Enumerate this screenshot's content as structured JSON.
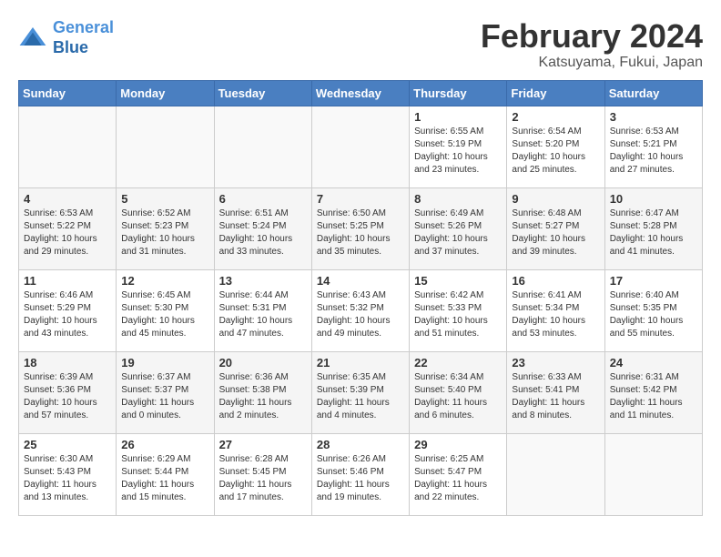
{
  "header": {
    "logo_line1": "General",
    "logo_line2": "Blue",
    "title": "February 2024",
    "subtitle": "Katsuyama, Fukui, Japan"
  },
  "weekdays": [
    "Sunday",
    "Monday",
    "Tuesday",
    "Wednesday",
    "Thursday",
    "Friday",
    "Saturday"
  ],
  "weeks": [
    [
      {
        "day": "",
        "info": ""
      },
      {
        "day": "",
        "info": ""
      },
      {
        "day": "",
        "info": ""
      },
      {
        "day": "",
        "info": ""
      },
      {
        "day": "1",
        "info": "Sunrise: 6:55 AM\nSunset: 5:19 PM\nDaylight: 10 hours\nand 23 minutes."
      },
      {
        "day": "2",
        "info": "Sunrise: 6:54 AM\nSunset: 5:20 PM\nDaylight: 10 hours\nand 25 minutes."
      },
      {
        "day": "3",
        "info": "Sunrise: 6:53 AM\nSunset: 5:21 PM\nDaylight: 10 hours\nand 27 minutes."
      }
    ],
    [
      {
        "day": "4",
        "info": "Sunrise: 6:53 AM\nSunset: 5:22 PM\nDaylight: 10 hours\nand 29 minutes."
      },
      {
        "day": "5",
        "info": "Sunrise: 6:52 AM\nSunset: 5:23 PM\nDaylight: 10 hours\nand 31 minutes."
      },
      {
        "day": "6",
        "info": "Sunrise: 6:51 AM\nSunset: 5:24 PM\nDaylight: 10 hours\nand 33 minutes."
      },
      {
        "day": "7",
        "info": "Sunrise: 6:50 AM\nSunset: 5:25 PM\nDaylight: 10 hours\nand 35 minutes."
      },
      {
        "day": "8",
        "info": "Sunrise: 6:49 AM\nSunset: 5:26 PM\nDaylight: 10 hours\nand 37 minutes."
      },
      {
        "day": "9",
        "info": "Sunrise: 6:48 AM\nSunset: 5:27 PM\nDaylight: 10 hours\nand 39 minutes."
      },
      {
        "day": "10",
        "info": "Sunrise: 6:47 AM\nSunset: 5:28 PM\nDaylight: 10 hours\nand 41 minutes."
      }
    ],
    [
      {
        "day": "11",
        "info": "Sunrise: 6:46 AM\nSunset: 5:29 PM\nDaylight: 10 hours\nand 43 minutes."
      },
      {
        "day": "12",
        "info": "Sunrise: 6:45 AM\nSunset: 5:30 PM\nDaylight: 10 hours\nand 45 minutes."
      },
      {
        "day": "13",
        "info": "Sunrise: 6:44 AM\nSunset: 5:31 PM\nDaylight: 10 hours\nand 47 minutes."
      },
      {
        "day": "14",
        "info": "Sunrise: 6:43 AM\nSunset: 5:32 PM\nDaylight: 10 hours\nand 49 minutes."
      },
      {
        "day": "15",
        "info": "Sunrise: 6:42 AM\nSunset: 5:33 PM\nDaylight: 10 hours\nand 51 minutes."
      },
      {
        "day": "16",
        "info": "Sunrise: 6:41 AM\nSunset: 5:34 PM\nDaylight: 10 hours\nand 53 minutes."
      },
      {
        "day": "17",
        "info": "Sunrise: 6:40 AM\nSunset: 5:35 PM\nDaylight: 10 hours\nand 55 minutes."
      }
    ],
    [
      {
        "day": "18",
        "info": "Sunrise: 6:39 AM\nSunset: 5:36 PM\nDaylight: 10 hours\nand 57 minutes."
      },
      {
        "day": "19",
        "info": "Sunrise: 6:37 AM\nSunset: 5:37 PM\nDaylight: 11 hours\nand 0 minutes."
      },
      {
        "day": "20",
        "info": "Sunrise: 6:36 AM\nSunset: 5:38 PM\nDaylight: 11 hours\nand 2 minutes."
      },
      {
        "day": "21",
        "info": "Sunrise: 6:35 AM\nSunset: 5:39 PM\nDaylight: 11 hours\nand 4 minutes."
      },
      {
        "day": "22",
        "info": "Sunrise: 6:34 AM\nSunset: 5:40 PM\nDaylight: 11 hours\nand 6 minutes."
      },
      {
        "day": "23",
        "info": "Sunrise: 6:33 AM\nSunset: 5:41 PM\nDaylight: 11 hours\nand 8 minutes."
      },
      {
        "day": "24",
        "info": "Sunrise: 6:31 AM\nSunset: 5:42 PM\nDaylight: 11 hours\nand 11 minutes."
      }
    ],
    [
      {
        "day": "25",
        "info": "Sunrise: 6:30 AM\nSunset: 5:43 PM\nDaylight: 11 hours\nand 13 minutes."
      },
      {
        "day": "26",
        "info": "Sunrise: 6:29 AM\nSunset: 5:44 PM\nDaylight: 11 hours\nand 15 minutes."
      },
      {
        "day": "27",
        "info": "Sunrise: 6:28 AM\nSunset: 5:45 PM\nDaylight: 11 hours\nand 17 minutes."
      },
      {
        "day": "28",
        "info": "Sunrise: 6:26 AM\nSunset: 5:46 PM\nDaylight: 11 hours\nand 19 minutes."
      },
      {
        "day": "29",
        "info": "Sunrise: 6:25 AM\nSunset: 5:47 PM\nDaylight: 11 hours\nand 22 minutes."
      },
      {
        "day": "",
        "info": ""
      },
      {
        "day": "",
        "info": ""
      }
    ]
  ]
}
